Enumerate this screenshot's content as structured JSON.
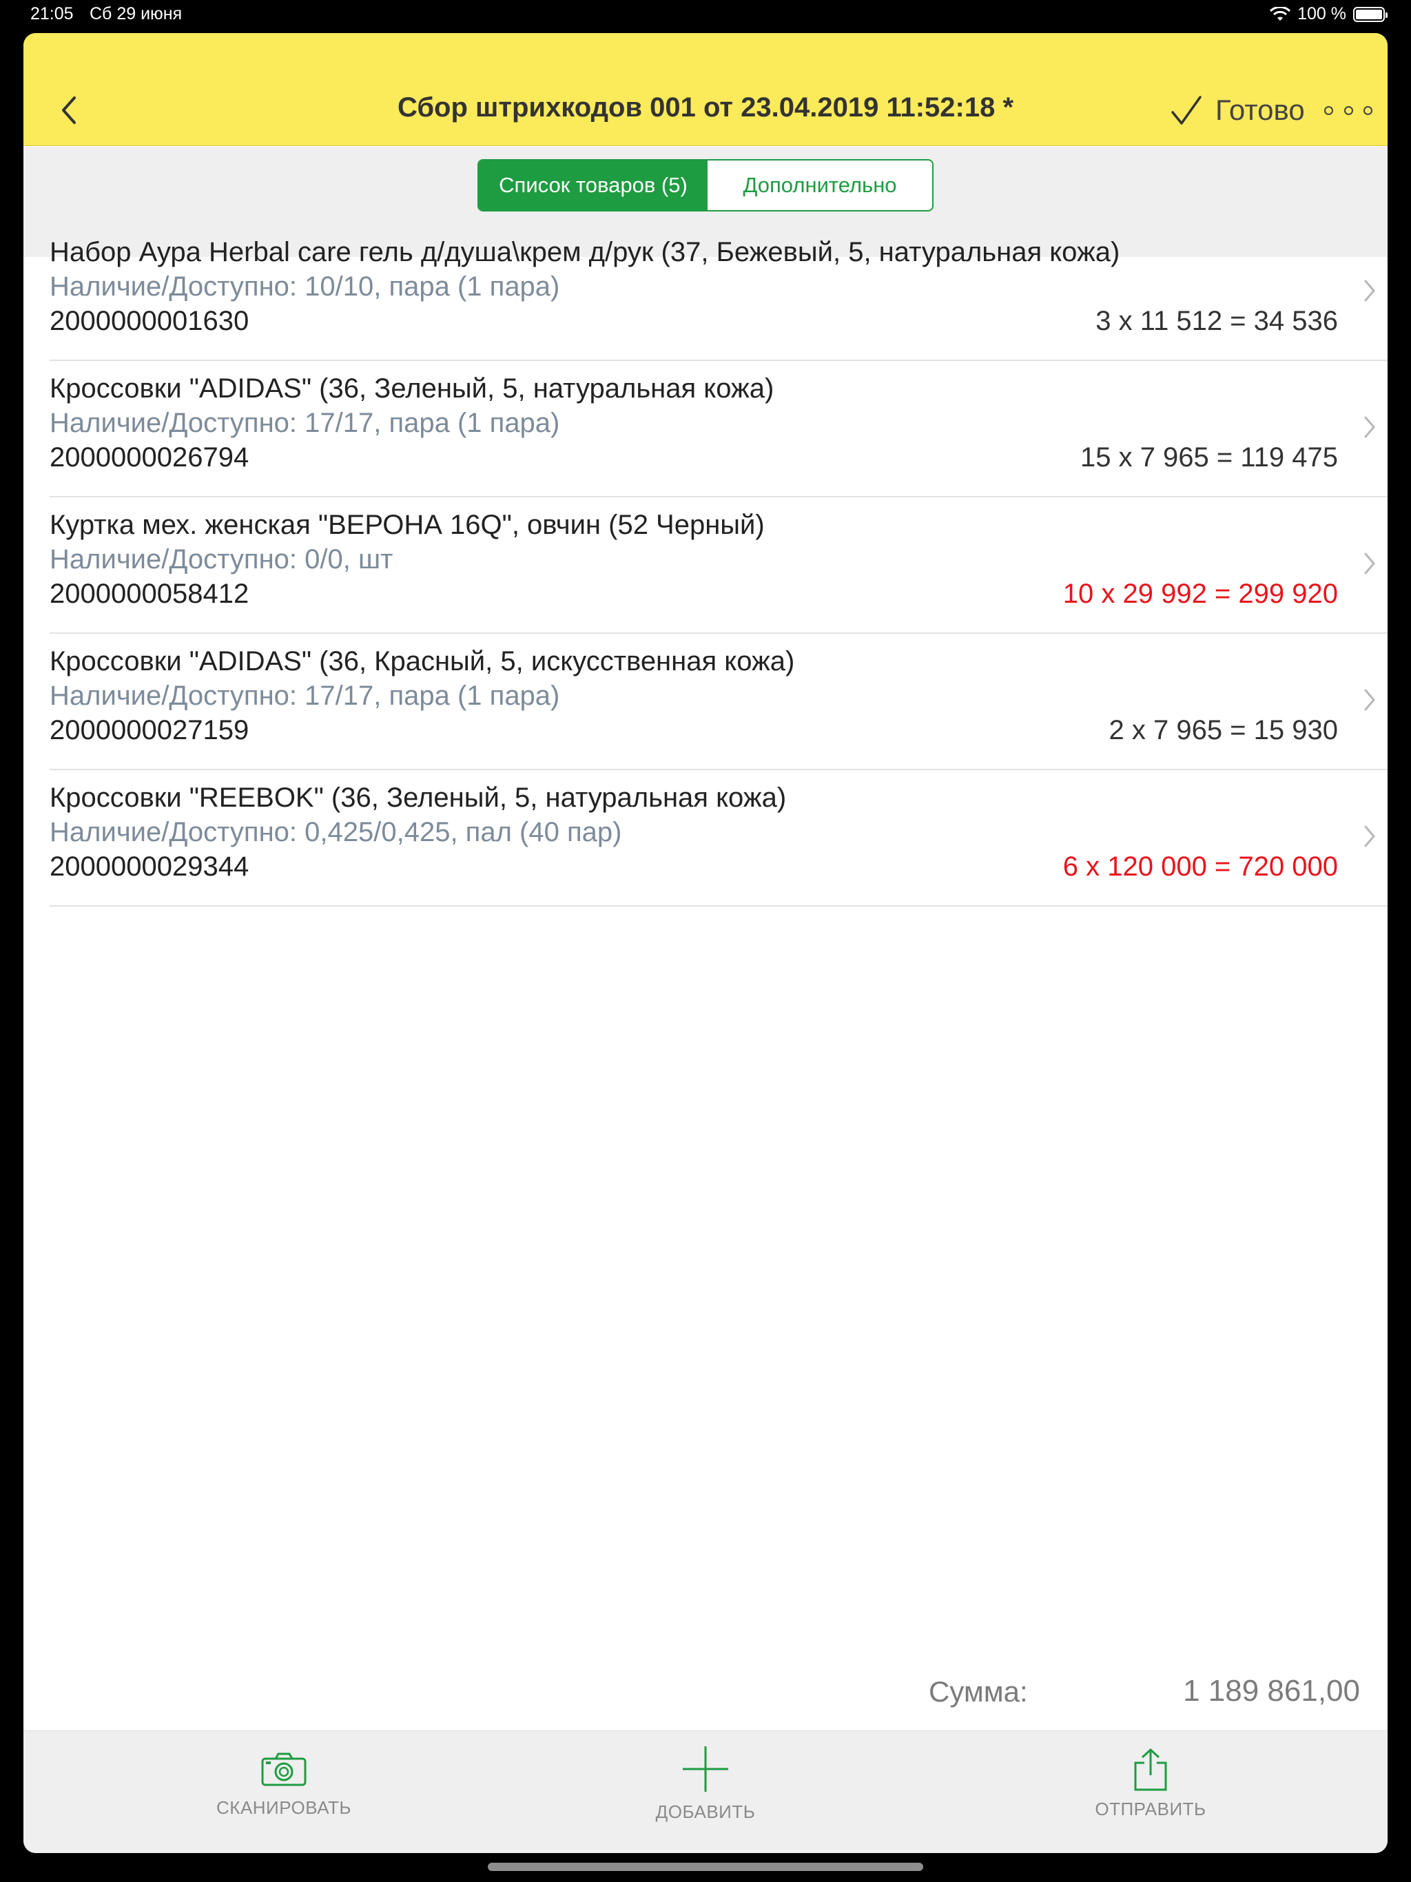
{
  "status_bar": {
    "time": "21:05",
    "date": "Сб 29 июня",
    "battery": "100 %"
  },
  "nav": {
    "title": "Сбор штрихкодов 001 от 23.04.2019 11:52:18 *",
    "done_label": "Готово"
  },
  "tabs": [
    {
      "label": "Список товаров (5)",
      "active": true
    },
    {
      "label": "Дополнительно",
      "active": false
    }
  ],
  "items": [
    {
      "name": "Набор Аура Herbal care гель д/душа\\крем д/рук (37, Бежевый, 5, натуральная кожа)",
      "stock": "Наличие/Доступно: 10/10, пара (1 пара)",
      "barcode": "2000000001630",
      "total": "3 x 11 512 = 34 536",
      "total_color": "#333333"
    },
    {
      "name": "Кроссовки \"ADIDAS\" (36, Зеленый, 5, натуральная кожа)",
      "stock": "Наличие/Доступно: 17/17, пара (1 пара)",
      "barcode": "2000000026794",
      "total": "15 x 7 965 = 119 475",
      "total_color": "#333333"
    },
    {
      "name": "Куртка мех. женская \"ВЕРОНА 16Q\", овчин (52 Черный)",
      "stock": "Наличие/Доступно: 0/0, шт",
      "barcode": "2000000058412",
      "total": "10 x 29 992 = 299 920",
      "total_color": "#e8141c"
    },
    {
      "name": "Кроссовки \"ADIDAS\" (36, Красный, 5, искусственная кожа)",
      "stock": "Наличие/Доступно: 17/17, пара (1 пара)",
      "barcode": "2000000027159",
      "total": "2 x 7 965 = 15 930",
      "total_color": "#333333"
    },
    {
      "name": "Кроссовки \"REEBOK\" (36, Зеленый, 5, натуральная кожа)",
      "stock": "Наличие/Доступно: 0,425/0,425, пал (40 пар)",
      "barcode": "2000000029344",
      "total": "6 x 120 000 = 720 000",
      "total_color": "#e8141c"
    }
  ],
  "summary": {
    "label": "Сумма:",
    "value": "1 189 861,00"
  },
  "toolbar": {
    "scan_label": "СКАНИРОВАТЬ",
    "add_label": "ДОБАВИТЬ",
    "send_label": "ОТПРАВИТЬ"
  },
  "colors": {
    "header_yellow": "#fbea5a",
    "accent_green": "#1e9c41",
    "warning_red": "#e8141c",
    "stock_gray": "#7d8b99"
  },
  "icons": [
    "back-chevron-icon",
    "checkmark-icon",
    "more-dots-icon",
    "chevron-right-icon",
    "camera-icon",
    "plus-icon",
    "share-icon",
    "wifi-icon",
    "battery-icon"
  ]
}
